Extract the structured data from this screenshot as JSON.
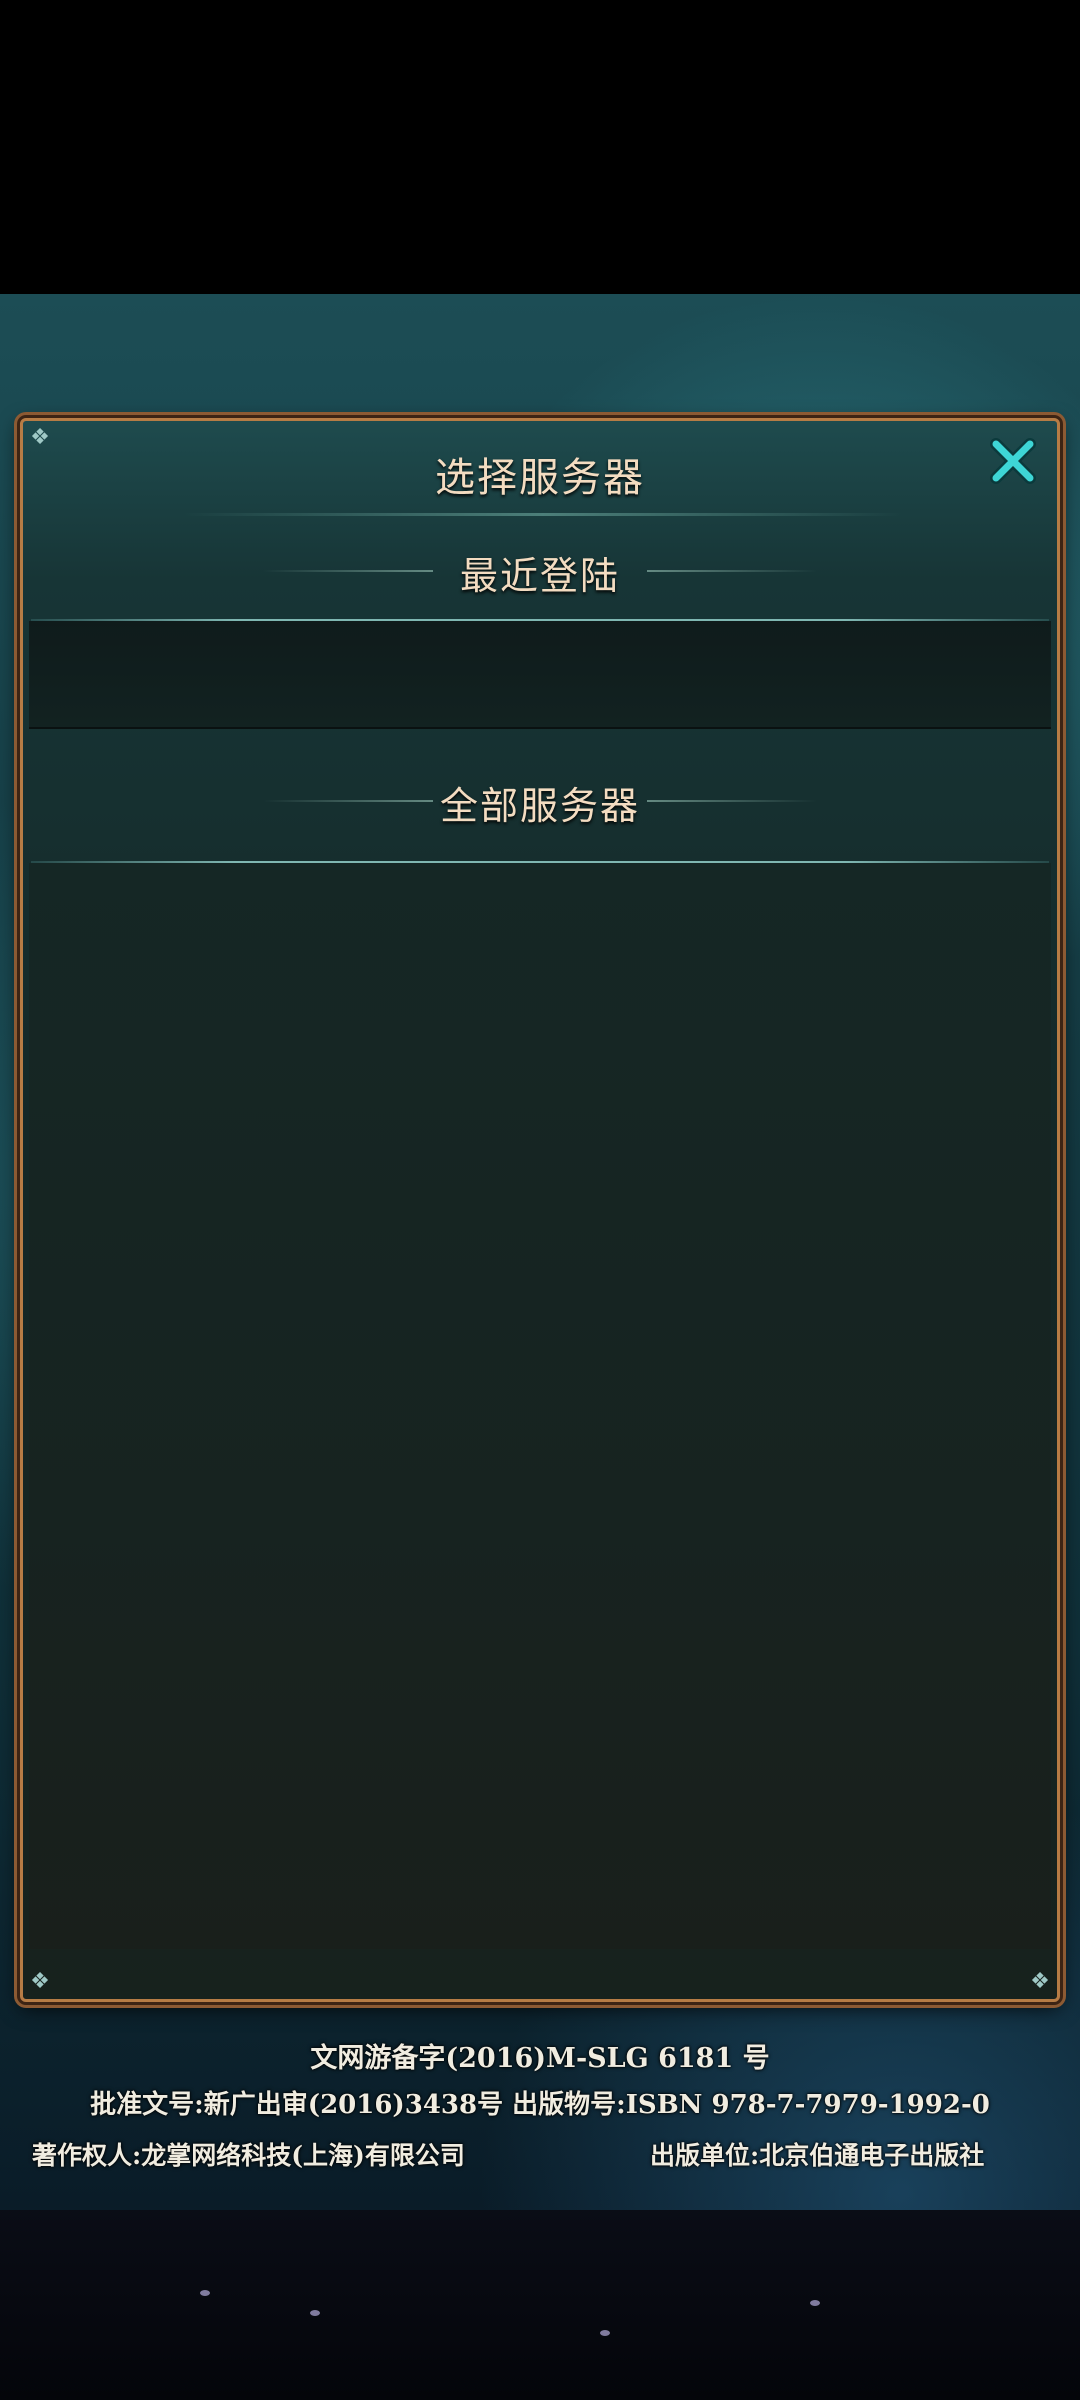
{
  "dialog": {
    "title": "选择服务器",
    "recent_header": "最近登陆",
    "all_header": "全部服务器",
    "close_icon": "close-x-icon",
    "accent_color": "#3ed6d6",
    "border_color": "#b67c45"
  },
  "footer": {
    "line1": "文网游备字(2016)M-SLG 6181 号",
    "line2": "批准文号:新广出审(2016)3438号   出版物号:ISBN 978-7-7979-1992-0",
    "copyright_holder": "著作权人:龙掌网络科技(上海)有限公司",
    "publisher": "出版单位:北京伯通电子出版社"
  }
}
